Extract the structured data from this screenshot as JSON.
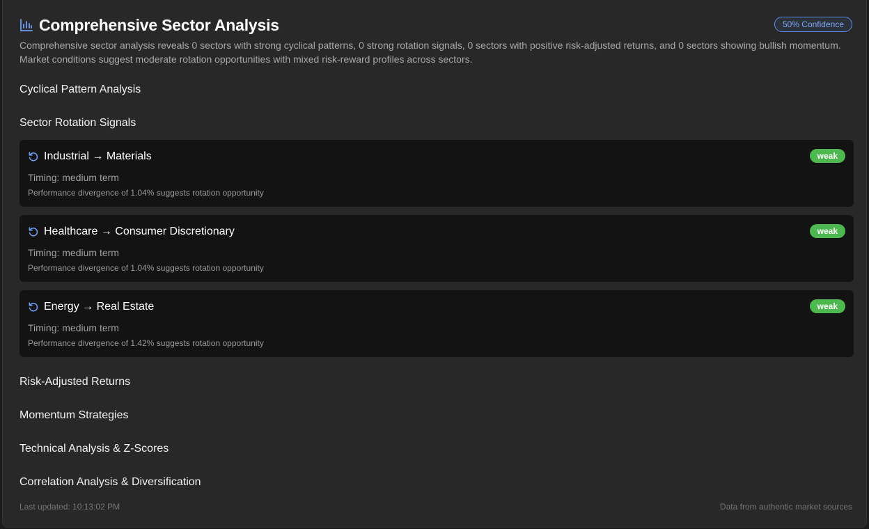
{
  "header": {
    "icon": "bar-chart-icon",
    "title": "Comprehensive Sector Analysis",
    "confidence": "50% Confidence",
    "description": "Comprehensive sector analysis reveals 0 sectors with strong cyclical patterns, 0 strong rotation signals, 0 sectors with positive risk-adjusted returns, and 0 sectors showing bullish momentum. Market conditions suggest moderate rotation opportunities with mixed risk-reward profiles across sectors."
  },
  "sections": {
    "cyclical": "Cyclical Pattern Analysis",
    "rotation": "Sector Rotation Signals",
    "risk": "Risk-Adjusted Returns",
    "momentum": "Momentum Strategies",
    "technical": "Technical Analysis & Z-Scores",
    "correlation": "Correlation Analysis & Diversification"
  },
  "rotation_signals": [
    {
      "icon": "rotate-icon",
      "name": "Industrial → Materials",
      "strength": "weak",
      "timing": "Timing: medium term",
      "note": "Performance divergence of 1.04% suggests rotation opportunity"
    },
    {
      "icon": "rotate-icon",
      "name": "Healthcare → Consumer Discretionary",
      "strength": "weak",
      "timing": "Timing: medium term",
      "note": "Performance divergence of 1.04% suggests rotation opportunity"
    },
    {
      "icon": "rotate-icon",
      "name": "Energy → Real Estate",
      "strength": "weak",
      "timing": "Timing: medium term",
      "note": "Performance divergence of 1.42% suggests rotation opportunity"
    }
  ],
  "footer": {
    "updated": "Last updated: 10:13:02 PM",
    "source": "Data from authentic market sources"
  },
  "colors": {
    "accent": "#5d8fea",
    "badge_weak": "#4db84f",
    "panel": "#282828",
    "card": "#131313"
  }
}
